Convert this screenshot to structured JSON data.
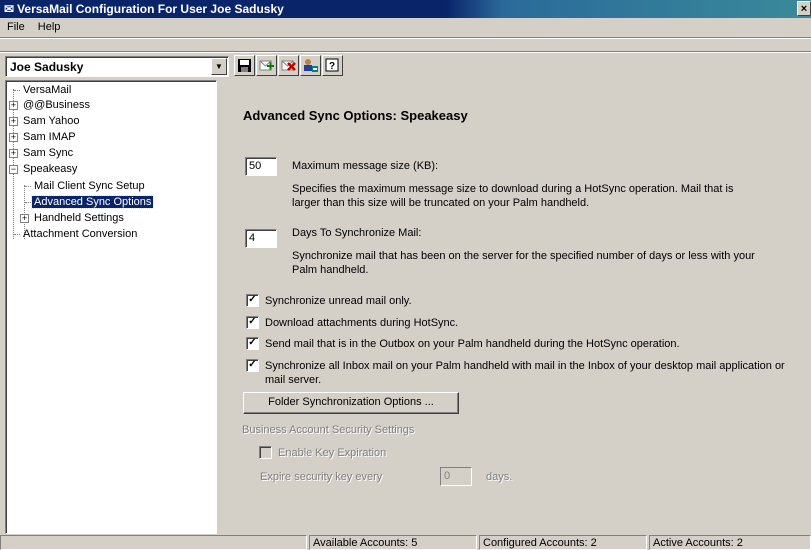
{
  "window": {
    "title": "VersaMail Configuration For User Joe Sadusky",
    "close_glyph": "×"
  },
  "menu": {
    "file": "File",
    "help": "Help"
  },
  "user_select": {
    "value": "Joe Sadusky"
  },
  "toolbar": {
    "buttons": [
      {
        "icon": "save-icon"
      },
      {
        "icon": "add-account-icon"
      },
      {
        "icon": "delete-account-icon"
      },
      {
        "icon": "user-settings-icon"
      },
      {
        "icon": "help-icon"
      }
    ]
  },
  "tree": {
    "items": [
      {
        "label": "VersaMail"
      },
      {
        "label": "@@Business",
        "expander": "+"
      },
      {
        "label": "Sam Yahoo",
        "expander": "+"
      },
      {
        "label": "Sam IMAP",
        "expander": "+"
      },
      {
        "label": "Sam Sync",
        "expander": "+"
      },
      {
        "label": "Speakeasy",
        "expander": "−"
      },
      {
        "label": "Mail Client Sync Setup"
      },
      {
        "label": "Advanced Sync Options",
        "selected": true
      },
      {
        "label": "Handheld Settings",
        "expander": "+"
      },
      {
        "label": "Attachment Conversion"
      }
    ]
  },
  "panel": {
    "title": "Advanced Sync Options: Speakeasy",
    "max_size": {
      "value": "50",
      "label": "Maximum message size (KB):",
      "description": "Specifies the maximum message size to download during a HotSync operation. Mail that is larger than this size will be truncated on your Palm handheld."
    },
    "days": {
      "value": "4",
      "label": "Days To Synchronize Mail:",
      "description": "Synchronize mail that has been on the server for the specified number of days or less with your Palm handheld."
    },
    "checkboxes": [
      {
        "label": "Synchronize unread mail only.",
        "checked": true
      },
      {
        "label": "Download attachments during HotSync.",
        "checked": true
      },
      {
        "label": "Send mail that is in the Outbox on your Palm handheld during the HotSync operation.",
        "checked": true
      },
      {
        "label": "Synchronize all Inbox mail on your Palm handheld with mail in the Inbox of your desktop mail application or mail server.",
        "checked": true
      }
    ],
    "folder_sync_button": "Folder Synchronization Options ...",
    "security": {
      "heading": "Business Account Security Settings",
      "enable_key_expiration": "Enable Key Expiration",
      "expire_label": "Expire security key every",
      "expire_value": "0",
      "days_label": "days."
    }
  },
  "status": {
    "available": "Available Accounts: 5",
    "configured": "Configured Accounts: 2",
    "active": "Active Accounts: 2"
  },
  "colors": {
    "selection": "#0a246a",
    "face": "#d4d0c8",
    "title_gradient_start": "#0a246a"
  }
}
